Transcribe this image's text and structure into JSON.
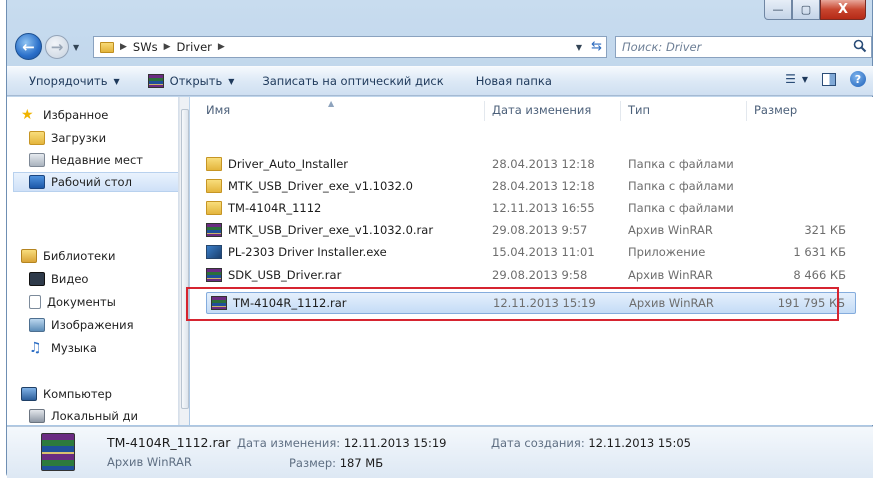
{
  "window": {
    "controls": {
      "minimize": "—",
      "maximize": "▢",
      "close": "X"
    }
  },
  "address": {
    "crumbs": [
      "SWs",
      "Driver"
    ],
    "search_placeholder": "Поиск: Driver"
  },
  "toolbar": {
    "organize": "Упорядочить",
    "open": "Открыть",
    "burn": "Записать на оптический диск",
    "new_folder": "Новая папка"
  },
  "nav": {
    "favorites": "Избранное",
    "downloads": "Загрузки",
    "recent": "Недавние мест",
    "desktop": "Рабочий стол",
    "libraries": "Библиотеки",
    "video": "Видео",
    "documents": "Документы",
    "images": "Изображения",
    "music": "Музыка",
    "computer": "Компьютер",
    "local_disk": "Локальный ди"
  },
  "columns": {
    "name": "Имя",
    "date": "Дата изменения",
    "type": "Тип",
    "size": "Размер"
  },
  "files": [
    {
      "name": "Driver_Auto_Installer",
      "date": "28.04.2013 12:18",
      "type": "Папка с файлами",
      "size": "",
      "icon": "folder-icon"
    },
    {
      "name": "MTK_USB_Driver_exe_v1.1032.0",
      "date": "28.04.2013 12:18",
      "type": "Папка с файлами",
      "size": "",
      "icon": "folder-icon"
    },
    {
      "name": "TM-4104R_1112",
      "date": "12.11.2013 16:55",
      "type": "Папка с файлами",
      "size": "",
      "icon": "folder-icon"
    },
    {
      "name": "MTK_USB_Driver_exe_v1.1032.0.rar",
      "date": "29.08.2013 9:57",
      "type": "Архив WinRAR",
      "size": "321 КБ",
      "icon": "winrar-icon"
    },
    {
      "name": "PL-2303 Driver Installer.exe",
      "date": "15.04.2013 11:01",
      "type": "Приложение",
      "size": "1 631 КБ",
      "icon": "installer-icon"
    },
    {
      "name": "SDK_USB_Driver.rar",
      "date": "29.08.2013 9:58",
      "type": "Архив WinRAR",
      "size": "8 466 КБ",
      "icon": "winrar-icon"
    },
    {
      "name": "TM-4104R_1112.rar",
      "date": "12.11.2013 15:19",
      "type": "Архив WinRAR",
      "size": "191 795 КБ",
      "icon": "winrar-icon",
      "selected": true
    }
  ],
  "details": {
    "name": "TM-4104R_1112.rar",
    "type": "Архив WinRAR",
    "modified_label": "Дата изменения:",
    "modified_value": "12.11.2013 15:19",
    "size_label": "Размер:",
    "size_value": "187 МБ",
    "created_label": "Дата создания:",
    "created_value": "12.11.2013 15:05"
  },
  "colors": {
    "highlight_border": "#d62430",
    "selection": "#c4dcf6"
  }
}
